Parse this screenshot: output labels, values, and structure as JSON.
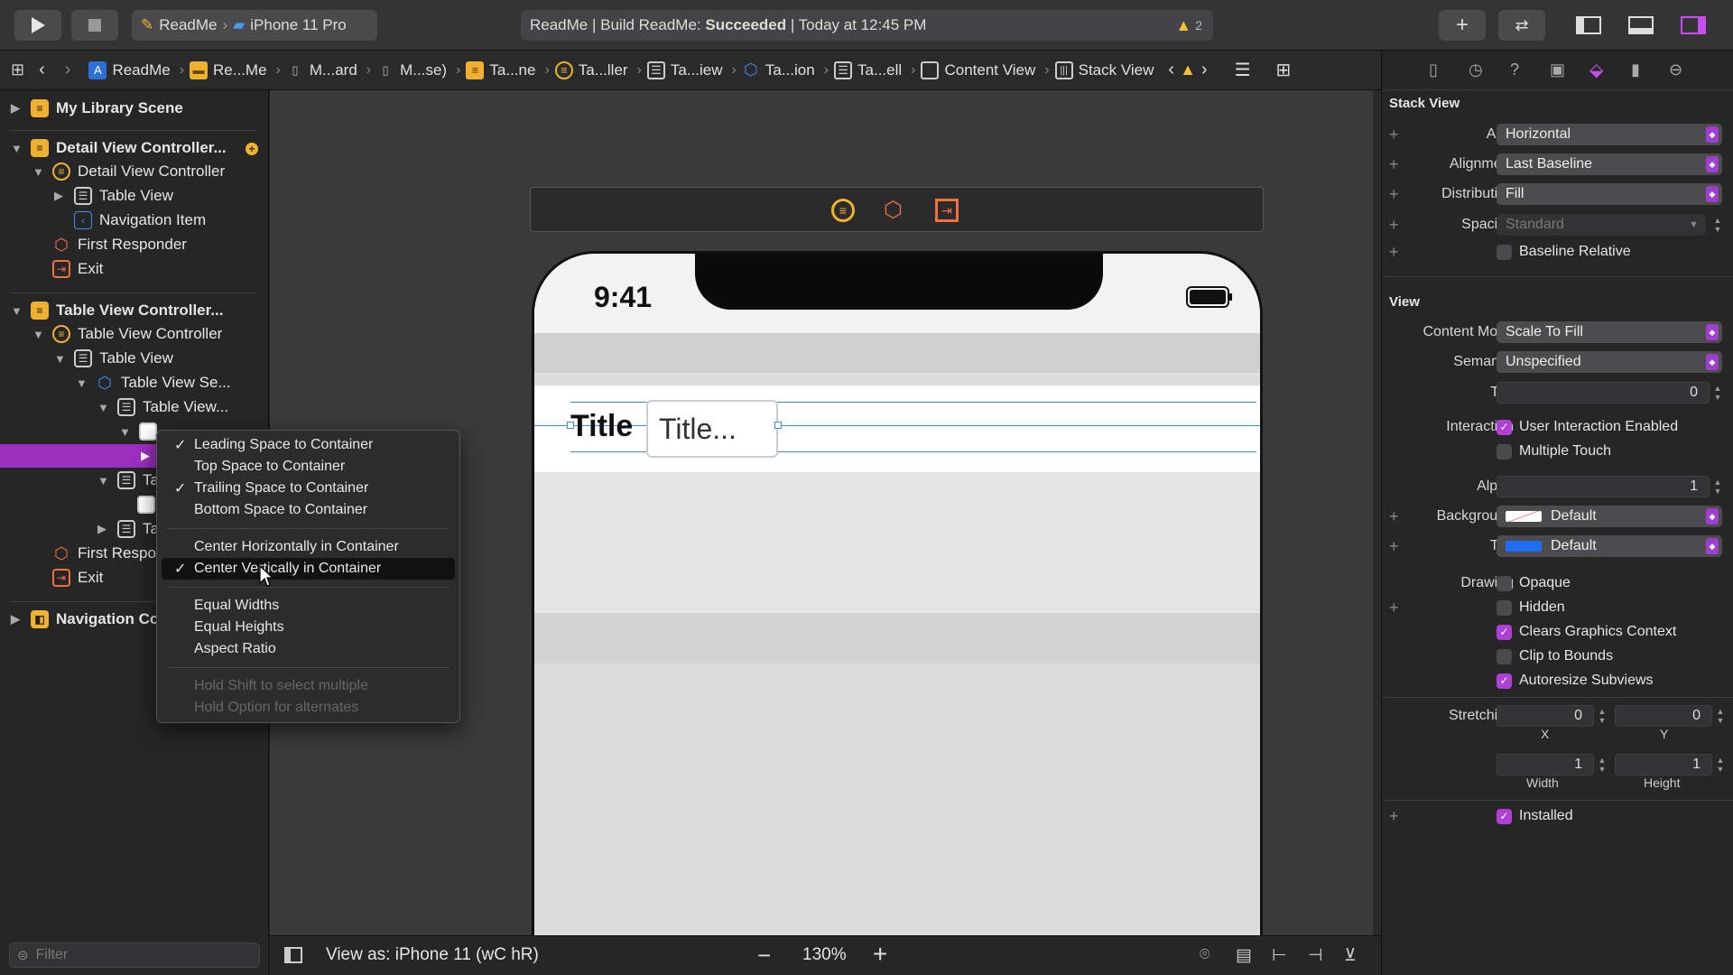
{
  "toolbar": {
    "scheme": "ReadMe",
    "device": "iPhone 11 Pro",
    "status_prefix": "ReadMe | Build ReadMe: ",
    "status_bold": "Succeeded",
    "status_suffix": " | Today at 12:45 PM",
    "warning_count": "2"
  },
  "jumpbar": {
    "crumbs": [
      "ReadMe",
      "Re...Me",
      "M...ard",
      "M...se)",
      "Ta...ne",
      "Ta...ller",
      "Ta...iew",
      "Ta...ion",
      "Ta...ell",
      "Content View",
      "Stack View"
    ]
  },
  "outline": {
    "items": [
      {
        "label": "My Library Scene"
      },
      {
        "label": "Detail View Controller..."
      },
      {
        "label": "Detail View Controller"
      },
      {
        "label": "Table View"
      },
      {
        "label": "Navigation Item"
      },
      {
        "label": "First Responder"
      },
      {
        "label": "Exit"
      },
      {
        "label": "Table View Controller..."
      },
      {
        "label": "Table View Controller"
      },
      {
        "label": "Table View"
      },
      {
        "label": "Table View Se..."
      },
      {
        "label": "Table View..."
      },
      {
        "label": "Ta"
      },
      {
        "label": "Ta"
      },
      {
        "label": "First Respo"
      },
      {
        "label": "Exit"
      },
      {
        "label": "Navigation Co"
      }
    ],
    "filter_placeholder": "Filter"
  },
  "menu": {
    "items": [
      {
        "label": "Leading Space to Container",
        "checked": true
      },
      {
        "label": "Top Space to Container",
        "checked": false
      },
      {
        "label": "Trailing Space to Container",
        "checked": true
      },
      {
        "label": "Bottom Space to Container",
        "checked": false
      },
      {
        "label": "Center Horizontally in Container",
        "checked": false
      },
      {
        "label": "Center Vertically in Container",
        "checked": true
      },
      {
        "label": "Equal Widths",
        "checked": false
      },
      {
        "label": "Equal Heights",
        "checked": false
      },
      {
        "label": "Aspect Ratio",
        "checked": false
      },
      {
        "label": "Hold Shift to select multiple",
        "checked": false
      },
      {
        "label": "Hold Option for alternates",
        "checked": false
      }
    ]
  },
  "device_preview": {
    "time": "9:41",
    "title_label": "Title",
    "title_field": "Title..."
  },
  "canvas_bar": {
    "view_as": "View as: iPhone 11 (",
    "size_class": "wC hR",
    "view_as_close": ")",
    "zoom": "130%"
  },
  "inspector": {
    "stack_view_header": "Stack View",
    "axis_label": "Axis",
    "axis_value": "Horizontal",
    "alignment_label": "Alignment",
    "alignment_value": "Last Baseline",
    "distribution_label": "Distribution",
    "distribution_value": "Fill",
    "spacing_label": "Spacing",
    "spacing_value": "Standard",
    "baseline_relative": "Baseline Relative",
    "view_header": "View",
    "content_mode_label": "Content Mode",
    "content_mode_value": "Scale To Fill",
    "semantic_label": "Semantic",
    "semantic_value": "Unspecified",
    "tag_label": "Tag",
    "tag_value": "0",
    "interaction_label": "Interaction",
    "user_interaction": "User Interaction Enabled",
    "multiple_touch": "Multiple Touch",
    "alpha_label": "Alpha",
    "alpha_value": "1",
    "background_label": "Background",
    "background_value": "Default",
    "tint_label": "Tint",
    "tint_value": "Default",
    "drawing_label": "Drawing",
    "opaque": "Opaque",
    "hidden": "Hidden",
    "clears_graphics": "Clears Graphics Context",
    "clip_to_bounds": "Clip to Bounds",
    "autoresize": "Autoresize Subviews",
    "stretching_label": "Stretching",
    "stretch_x": "0",
    "stretch_y": "0",
    "stretch_w": "1",
    "stretch_h": "1",
    "x_label": "X",
    "y_label": "Y",
    "width_label": "Width",
    "height_label": "Height",
    "installed": "Installed"
  },
  "colors": {
    "accent": "#b03fd6",
    "tint_blue": "#1f6cf5",
    "warning": "#f5c12e"
  }
}
